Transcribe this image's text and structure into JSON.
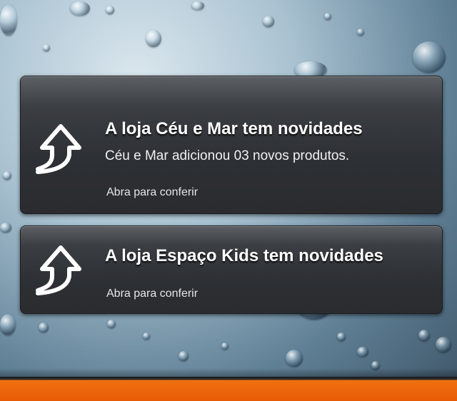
{
  "notifications": [
    {
      "title": "A loja Céu e Mar tem novidades",
      "body": "Céu e Mar adicionou 03 novos produtos.",
      "action": "Abra para conferir",
      "icon": "share-arrow-icon"
    },
    {
      "title": "A loja Espaço Kids tem novidades",
      "action": "Abra para conferir",
      "icon": "share-arrow-icon"
    }
  ],
  "colors": {
    "card": "#2d3034",
    "accent_bar": "#e65c06",
    "text": "#ffffff"
  }
}
